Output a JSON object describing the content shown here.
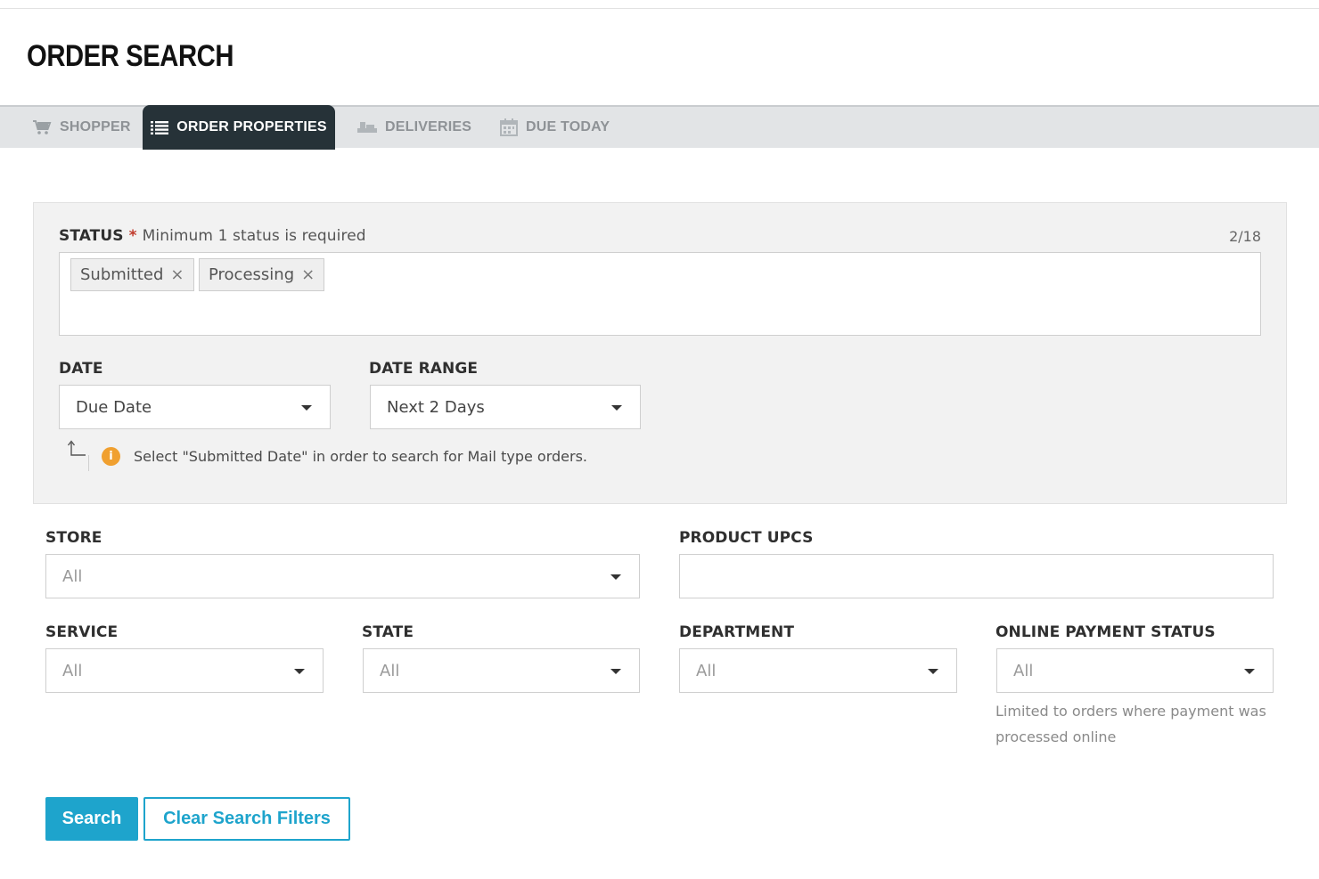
{
  "header": {
    "title": "ORDER SEARCH"
  },
  "tabs": [
    {
      "label": "SHOPPER",
      "icon": "cart-icon",
      "active": false
    },
    {
      "label": "ORDER PROPERTIES",
      "icon": "list-icon",
      "active": true
    },
    {
      "label": "DELIVERIES",
      "icon": "truck-icon",
      "active": false
    },
    {
      "label": "DUE TODAY",
      "icon": "calendar-icon",
      "active": false
    }
  ],
  "status": {
    "label": "STATUS",
    "required_mark": "*",
    "note": "Minimum 1 status is required",
    "count": "2/18",
    "tags": [
      "Submitted",
      "Processing"
    ],
    "remove_glyph": "×"
  },
  "date": {
    "label": "DATE",
    "value": "Due Date"
  },
  "date_range": {
    "label": "DATE RANGE",
    "value": "Next 2 Days"
  },
  "hint": {
    "icon": "info-icon",
    "glyph": "i",
    "text": "Select \"Submitted Date\" in order to search for Mail type orders."
  },
  "store": {
    "label": "STORE",
    "value": "All"
  },
  "product_upcs": {
    "label": "PRODUCT UPCS",
    "value": ""
  },
  "service": {
    "label": "SERVICE",
    "value": "All"
  },
  "state": {
    "label": "STATE",
    "value": "All"
  },
  "department": {
    "label": "DEPARTMENT",
    "value": "All"
  },
  "online_payment_status": {
    "label": "ONLINE PAYMENT STATUS",
    "value": "All",
    "help": "Limited to orders where payment was processed online"
  },
  "actions": {
    "search": "Search",
    "clear": "Clear Search Filters"
  },
  "colors": {
    "accent": "#1ea4cc",
    "active_tab": "#263238",
    "warning": "#f0a030",
    "required": "#c0392b"
  }
}
